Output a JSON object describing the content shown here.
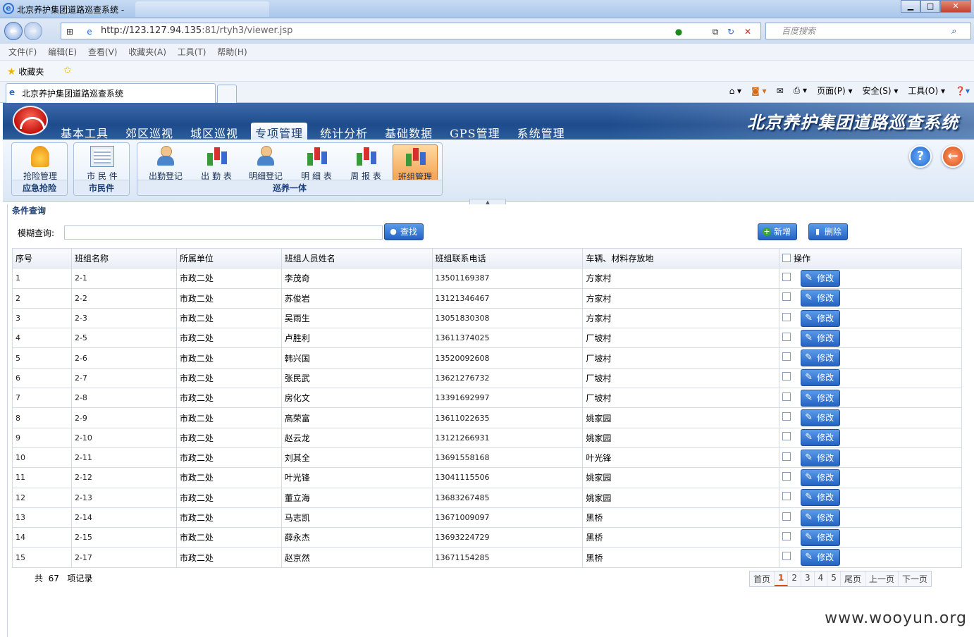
{
  "browser": {
    "window_title": "北京养护集团道路巡查系统 -",
    "url_host": "http://123.127.94.135",
    "url_rest": ":81/rtyh3/viewer.jsp",
    "search_placeholder": "百度搜索",
    "menu": [
      "文件(F)",
      "编辑(E)",
      "查看(V)",
      "收藏夹(A)",
      "工具(T)",
      "帮助(H)"
    ],
    "favorites_label": "收藏夹",
    "tab_title": "北京养护集团道路巡查系统",
    "commands": [
      "页面(P) ▾",
      "安全(S) ▾",
      "工具(O) ▾"
    ],
    "win_min": "▁",
    "win_max": "□",
    "win_close": "✕"
  },
  "app": {
    "system_name": "北京养护集团道路巡查系统",
    "topnav": [
      "基本工具",
      "郊区巡视",
      "城区巡视",
      "专项管理",
      "统计分析",
      "基础数据",
      "GPS管理",
      "系统管理"
    ],
    "active_topnav": "专项管理",
    "tool_groups": [
      {
        "label": "应急抢险",
        "tools": [
          {
            "label": "抢险管理",
            "icon": "alarm-icon"
          }
        ]
      },
      {
        "label": "市民件",
        "tools": [
          {
            "label": "市 民 件",
            "icon": "board-icon"
          }
        ]
      },
      {
        "label": "巡养一体",
        "tools": [
          {
            "label": "出勤登记",
            "icon": "person-icon"
          },
          {
            "label": "出 勤 表",
            "icon": "chart-icon"
          },
          {
            "label": "明细登记",
            "icon": "person-icon"
          },
          {
            "label": "明 细 表",
            "icon": "chart-icon"
          },
          {
            "label": "周 报 表",
            "icon": "chart-icon"
          },
          {
            "label": "班组管理",
            "icon": "chart-icon",
            "selected": true
          }
        ]
      }
    ],
    "help_icon": "?",
    "back_icon": "←"
  },
  "query": {
    "section_title": "条件查询",
    "fuzzy_label": "模糊查询:",
    "fuzzy_value": "",
    "search_button": "查找",
    "add_button": "新增",
    "delete_button": "删除"
  },
  "table": {
    "columns": [
      "序号",
      "班组名称",
      "所属单位",
      "班组人员姓名",
      "班组联系电话",
      "车辆、材料存放地",
      "操作"
    ],
    "edit_label": "修改",
    "rows": [
      [
        "1",
        "2-1",
        "市政二处",
        "李茂奇",
        "13501169387",
        "方家村"
      ],
      [
        "2",
        "2-2",
        "市政二处",
        "苏俊岩",
        "13121346467",
        "方家村"
      ],
      [
        "3",
        "2-3",
        "市政二处",
        "吴雨生",
        "13051830308",
        "方家村"
      ],
      [
        "4",
        "2-5",
        "市政二处",
        "卢胜利",
        "13611374025",
        "厂坡村"
      ],
      [
        "5",
        "2-6",
        "市政二处",
        "韩兴国",
        "13520092608",
        "厂坡村"
      ],
      [
        "6",
        "2-7",
        "市政二处",
        "张民武",
        "13621276732",
        "厂坡村"
      ],
      [
        "7",
        "2-8",
        "市政二处",
        "房化文",
        "13391692997",
        "厂坡村"
      ],
      [
        "8",
        "2-9",
        "市政二处",
        "高荣富",
        "13611022635",
        "姚家园"
      ],
      [
        "9",
        "2-10",
        "市政二处",
        "赵云龙",
        "13121266931",
        "姚家园"
      ],
      [
        "10",
        "2-11",
        "市政二处",
        "刘其全",
        "13691558168",
        "叶光锋"
      ],
      [
        "11",
        "2-12",
        "市政二处",
        "叶光锋",
        "13041115506",
        "姚家园"
      ],
      [
        "12",
        "2-13",
        "市政二处",
        "董立海",
        "13683267485",
        "姚家园"
      ],
      [
        "13",
        "2-14",
        "市政二处",
        "马志凯",
        "13671009097",
        "黑桥"
      ],
      [
        "14",
        "2-15",
        "市政二处",
        "薛永杰",
        "13693224729",
        "黑桥"
      ],
      [
        "15",
        "2-17",
        "市政二处",
        "赵京然",
        "13671154285",
        "黑桥"
      ]
    ]
  },
  "footer": {
    "total_prefix": "共",
    "total_count": "67",
    "total_suffix": "项记录",
    "pager": [
      "首页",
      "1",
      "2",
      "3",
      "4",
      "5",
      "尾页",
      "上一页",
      "下一页"
    ],
    "current_page": "1"
  },
  "watermark": "www.wooyun.org"
}
